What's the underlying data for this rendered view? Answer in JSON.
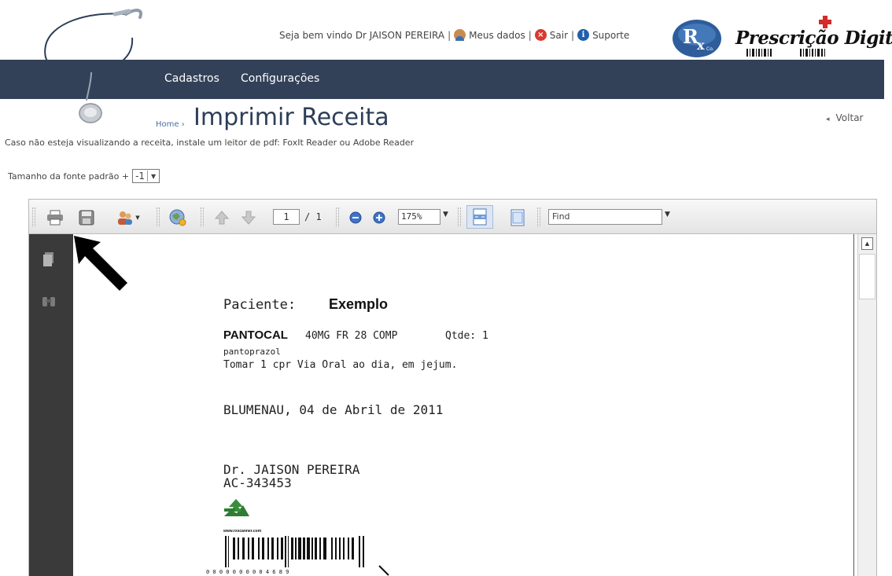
{
  "header": {
    "greeting": "Seja bem vindo Dr JAISON PEREIRA",
    "my_data": "Meus dados",
    "logout": "Sair",
    "support": "Suporte",
    "brand": "Prescrição Digital",
    "rx_logo_text": "Rx",
    "rx_logo_sub": "Co."
  },
  "nav": {
    "items": [
      {
        "label": "Cadastros"
      },
      {
        "label": "Configurações"
      }
    ]
  },
  "page": {
    "breadcrumb": "Home ›",
    "title": "Imprimir Receita",
    "back": "Voltar",
    "instructions": "Caso não esteja visualizando a receita, instale um leitor de pdf: FoxIt Reader ou Adobe Reader",
    "font_size_label": "Tamanho da fonte padrão +",
    "font_size_value": "-1"
  },
  "viewer": {
    "page_current": "1",
    "page_total": "/ 1",
    "zoom": "175%",
    "find_placeholder": "Find"
  },
  "document": {
    "patient_label": "Paciente:",
    "patient_name": "Exemplo",
    "med_name": "PANTOCAL",
    "med_dose": "40MG FR 28 COMP",
    "med_qty": "Qtde: 1",
    "med_generic": "pantoprazol",
    "med_instructions": "Tomar 1 cpr Via Oral ao dia, em jejum.",
    "place_date": "BLUMENAU, 04 de Abril de 2011",
    "doctor_name": "Dr. JAISON PEREIRA",
    "doctor_reg": "AC-343453",
    "barcode_url": "www.rxscanner.com",
    "barcode_digits": "0  0 0 0 0 0 0  0 0 4 6 8 9"
  },
  "colors": {
    "navbar": "#324158",
    "title": "#2d3e58",
    "link": "#4a6fa5",
    "viewer_side": "#3a3a3a"
  },
  "icons": [
    "stethoscope-logo",
    "user-icon",
    "close-icon",
    "info-icon",
    "print-icon",
    "save-icon",
    "users-icon",
    "globe-icon",
    "arrow-up-icon",
    "arrow-down-icon",
    "zoom-out-icon",
    "zoom-in-icon",
    "fit-width-icon",
    "fit-page-icon",
    "pages-icon",
    "binoculars-icon"
  ]
}
